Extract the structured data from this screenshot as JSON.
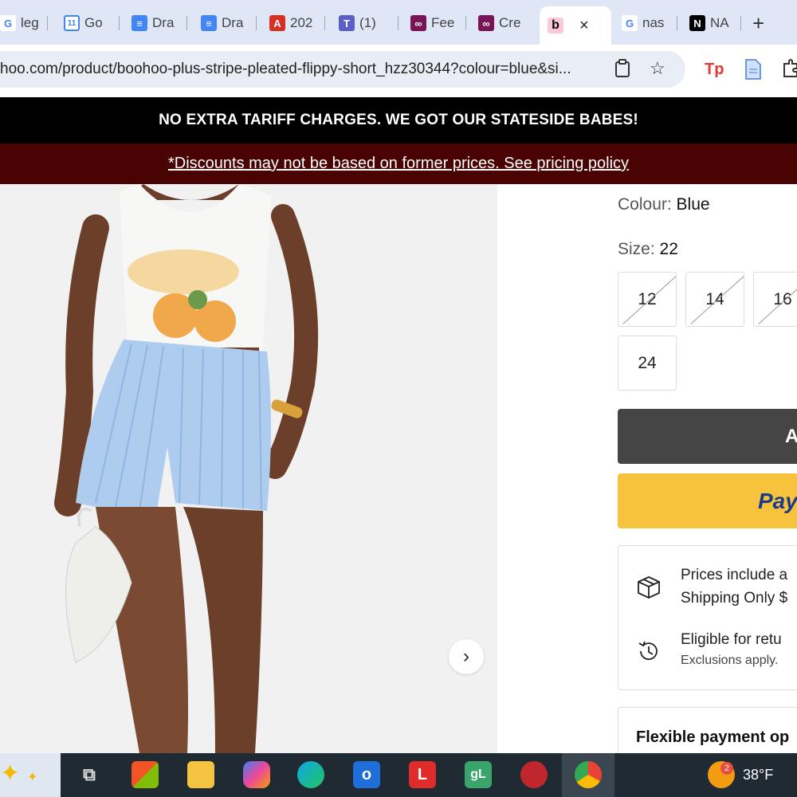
{
  "browser": {
    "tabs": [
      {
        "label": "leg",
        "icon": "google-icon"
      },
      {
        "label": "Go",
        "icon": "google-calendar-icon"
      },
      {
        "label": "Dra",
        "icon": "google-docs-icon"
      },
      {
        "label": "Dra",
        "icon": "google-docs-icon"
      },
      {
        "label": "202",
        "icon": "pdf-icon"
      },
      {
        "label": "(1)",
        "icon": "teams-icon"
      },
      {
        "label": "Fee",
        "icon": "link-icon"
      },
      {
        "label": "Cre",
        "icon": "link-icon"
      },
      {
        "label": "",
        "icon": "boohoo-icon",
        "close": "×"
      },
      {
        "label": "nas",
        "icon": "google-icon"
      },
      {
        "label": "NA",
        "icon": "notion-icon"
      }
    ],
    "new_tab": "+",
    "url": "hoo.com/product/boohoo-plus-stripe-pleated-flippy-short_hzz30344?colour=blue&si..."
  },
  "banners": {
    "tariff": "NO EXTRA TARIFF CHARGES. WE GOT OUR STATESIDE BABES!",
    "pricing": "*Discounts may not be based on former prices. See pricing policy"
  },
  "product": {
    "next_arrow": "›",
    "colour_label": "Colour:",
    "colour_value": "Blue",
    "size_label": "Size:",
    "size_value": "22",
    "sizes": [
      {
        "label": "12",
        "available": false
      },
      {
        "label": "14",
        "available": false
      },
      {
        "label": "16",
        "available": false
      },
      {
        "label": "24",
        "available": true
      }
    ],
    "add_button": "A",
    "paypal_button": "Pay",
    "info": {
      "line1": "Prices include a",
      "line2": "Shipping Only $",
      "line3": "Eligible for retu",
      "line4": "Exclusions apply."
    },
    "flexible": "Flexible payment op"
  },
  "taskbar": {
    "badge": "2",
    "temperature": "38°F"
  },
  "colors": {
    "banner_black": "#000000",
    "banner_maroon": "#4a0303",
    "add_button": "#454545",
    "paypal": "#f7c33c"
  }
}
